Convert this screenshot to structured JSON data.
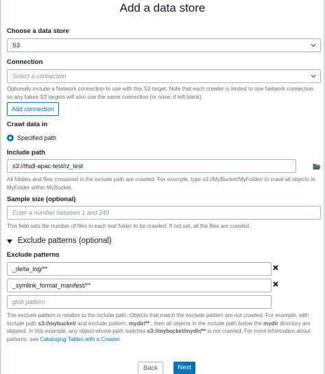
{
  "page": {
    "title": "Add a data store"
  },
  "data_store": {
    "label": "Choose a data store",
    "value": "S3"
  },
  "connection": {
    "label": "Connection",
    "placeholder": "Select a connection",
    "description": "Optionally include a Network connection to use with this S3 target. Note that each crawler is limited to one Network connection so any future S3 targets will also use the same connection (or none, if left blank).",
    "add_button": "Add connection"
  },
  "crawl_data": {
    "label": "Crawl data in",
    "option": "Specified path"
  },
  "include_path": {
    "label": "Include path",
    "value": "s3://tfsdl-apac-test/rz_test",
    "description": "All folders and files contained in the include path are crawled. For example, type s3://MyBucket/MyFolder/ to crawl all objects in MyFolder within MyBucket."
  },
  "sample_size": {
    "label": "Sample size (optional)",
    "placeholder": "Enter a number between 1 and 249",
    "description": "This field sets the number of files in each leaf folder to be crawled. If not set, all the files are crawled."
  },
  "exclude_section": {
    "label": "Exclude patterns (optional)"
  },
  "exclude_patterns": {
    "label": "Exclude patterns",
    "items": [
      "_delta_log/**",
      "_symlink_format_manifest/**"
    ],
    "placeholder": "glob pattern",
    "desc": {
      "p1": "The exclude pattern is relative to the include path. Objects that match the exclude pattern are not crawled. For example, with include path ",
      "b1": "s3://mybucket/",
      "p2": " and exclude pattern, ",
      "b2": "mydir/**",
      "p3": " , then all objects in the include path below the ",
      "b3": "mydir",
      "p4": " directory are skipped. In this example, any object whose path matches ",
      "b4": "s3://mybucket/mydir/**",
      "p5": " is not crawled. For more information about patterns, see ",
      "link": "Cataloging Tables with a Crawler",
      "p6": "."
    }
  },
  "footer": {
    "back": "Back",
    "next": "Next"
  },
  "icons": {
    "select_caret": "chevron-down-icon",
    "folder": "folder-open-icon",
    "remove": "close-icon",
    "expand": "caret-down-icon"
  },
  "colors": {
    "accent": "#0073bb",
    "border": "#aab7b8",
    "muted_text": "#687078"
  }
}
